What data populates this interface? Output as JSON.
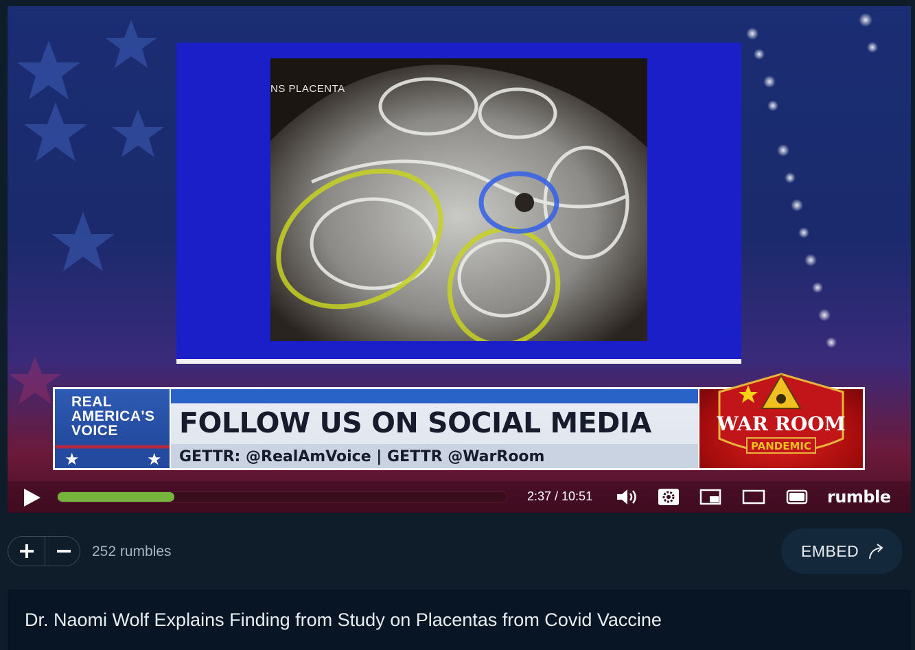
{
  "player": {
    "slide": {
      "ultrasound_label": "NS PLACENTA"
    },
    "lower_third": {
      "brand_lines": [
        "REAL",
        "AMERICA'S",
        "VOICE"
      ],
      "headline": "FOLLOW US ON SOCIAL MEDIA",
      "subline": "GETTR: @RealAmVoice | GETTR @WarRoom",
      "warroom_title": "WAR ROOM",
      "warroom_sub": "PANDEMIC"
    },
    "controls": {
      "progress_fraction": 0.26,
      "time": "2:37 / 10:51",
      "logo": "rumble",
      "icons": [
        "play-icon",
        "volume-icon",
        "settings-icon",
        "pip-icon",
        "theater-icon",
        "fullscreen-icon"
      ]
    },
    "colors": {
      "progress": "#75b53b",
      "slide_bg": "#1b1fc7"
    }
  },
  "engagement": {
    "rumbles": "252 rumbles",
    "embed_label": "EMBED"
  },
  "video": {
    "title": "Dr. Naomi Wolf Explains Finding from Study on Placentas from Covid Vaccine"
  }
}
